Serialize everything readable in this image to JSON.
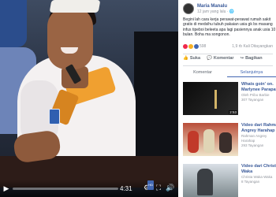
{
  "player": {
    "current_time": "4:31",
    "progress_fraction": 0.0,
    "hd_label": "HD"
  },
  "post": {
    "author": "Maria Manalu",
    "meta": "12 jam yang lalu · 🌐",
    "caption": "Begini lah cara kerja perawat-perawat rumah sakit gratis di medsihu tubuh pakaian usia gk bs masang infus tipeboi beleeta apa lagi pasiennya anak usia 10 bulan. Boha ma songonon.",
    "reaction_count": "598",
    "view_count": "1,9 rb Kali Ditayangkan",
    "share_count": "897 Ribu",
    "actions": {
      "like": "Suka",
      "comment": "Komentar",
      "share": "Bagikan"
    },
    "tabs": {
      "comments": "Komentar",
      "next": "Selanjutnya"
    }
  },
  "related": [
    {
      "title": "Whats goin' on. Marlynee Parapat",
      "sub": "Oleh Pribo Barbie\n307 Tayangan",
      "duration": "2:53"
    },
    {
      "title": "Video dari Rahman Angrey Harahap",
      "sub": "Rahman Angrey Harahap\n293 Tayangan",
      "duration": ""
    },
    {
      "title": "Video dari Christa Waka",
      "sub": "Christa Waka Waka\n8 Tayangan",
      "duration": ""
    }
  ],
  "colors": {
    "link": "#385898",
    "accent": "#4267b2",
    "muted": "#90949c"
  }
}
